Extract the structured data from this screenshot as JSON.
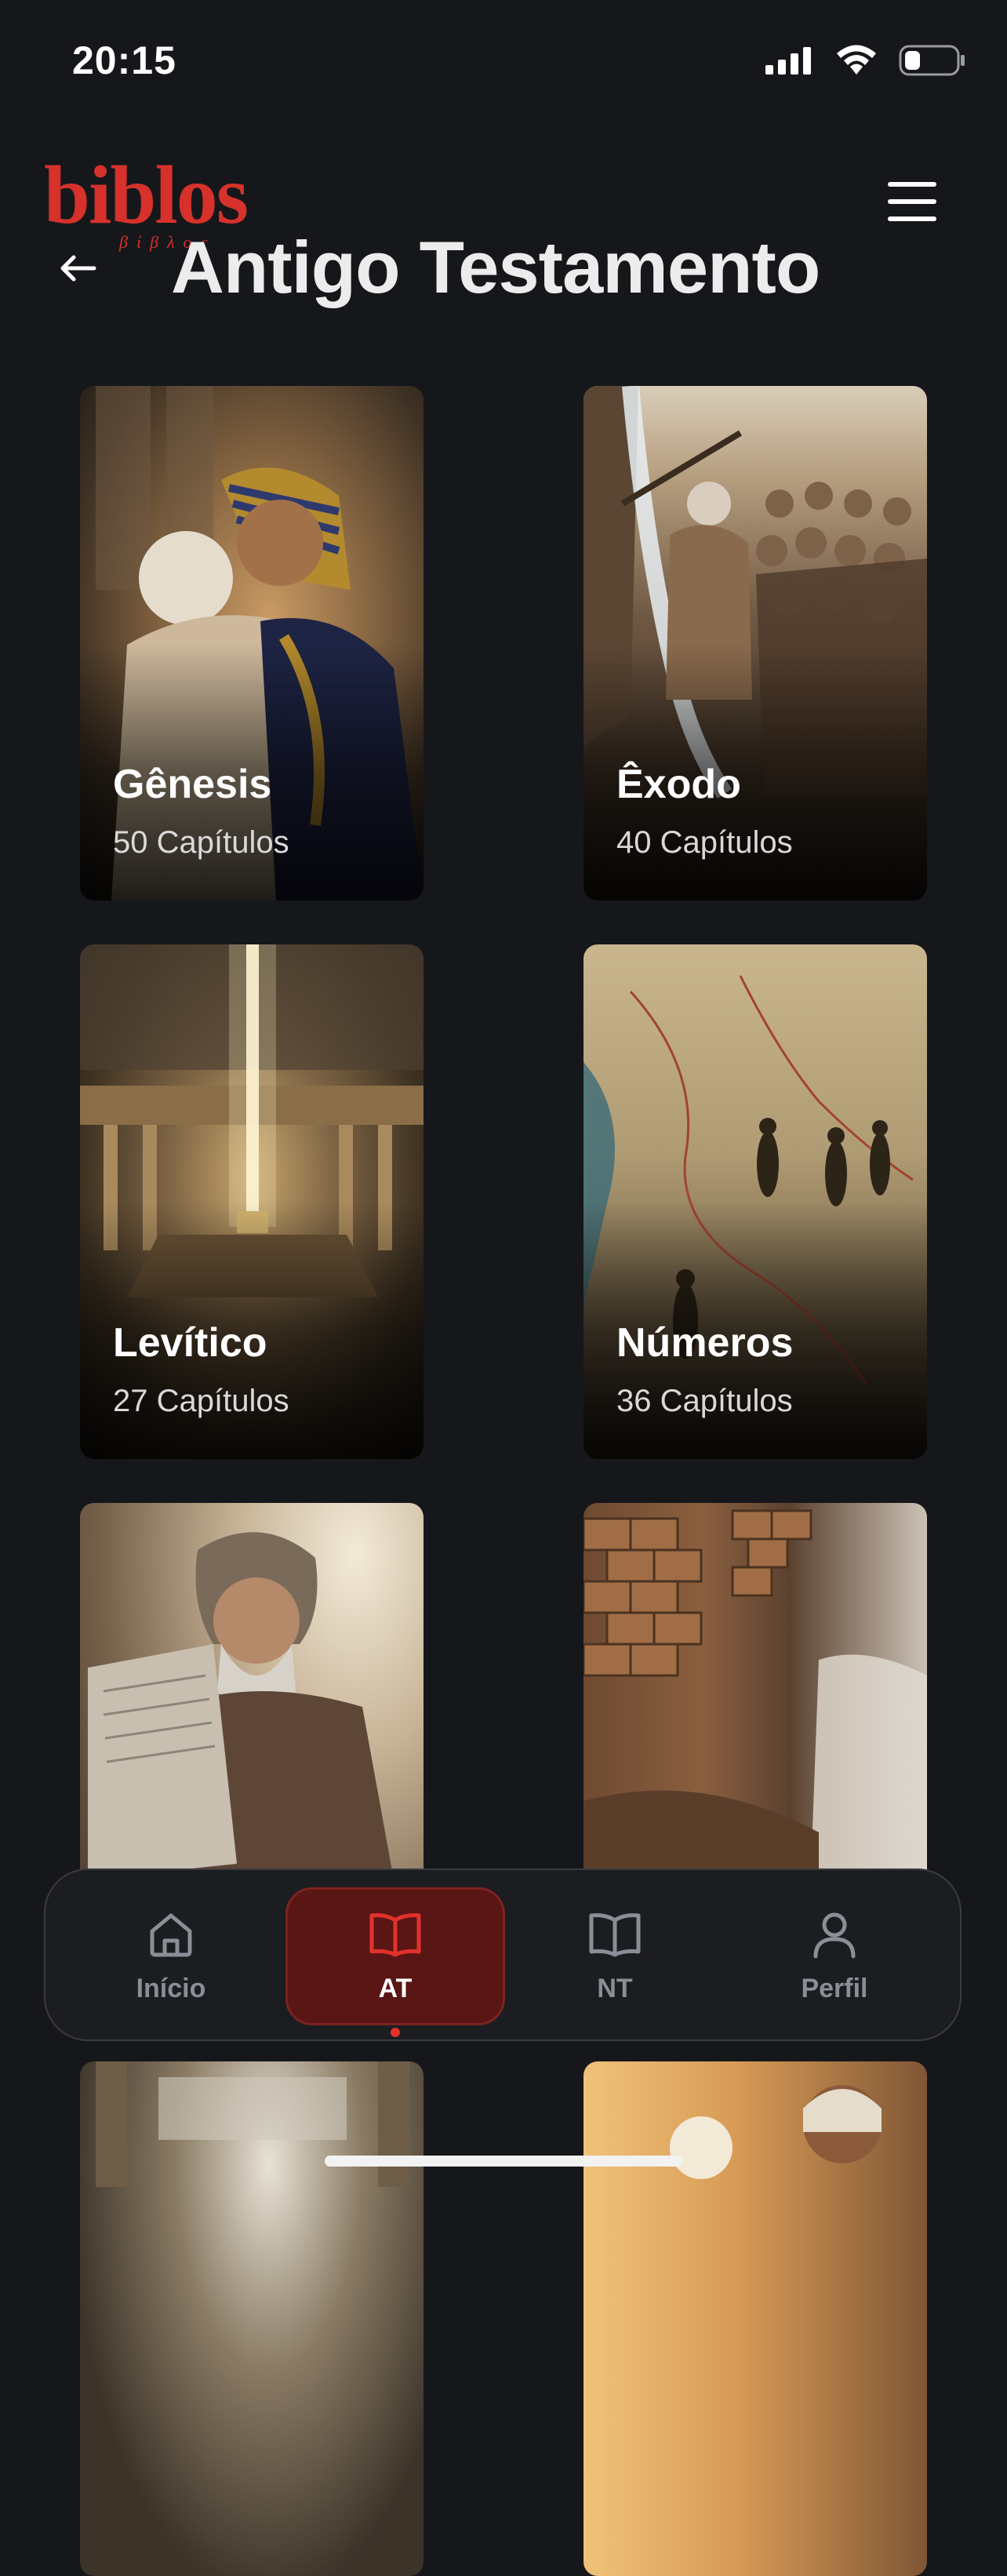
{
  "status_bar": {
    "time": "20:15",
    "battery_level": 0.3
  },
  "header": {
    "logo_text": "biblos",
    "logo_subtext": "βίβλος",
    "title": "Antigo Testamento",
    "back_icon": "arrow-left-icon",
    "menu_icon": "hamburger-menu-icon"
  },
  "books": [
    {
      "name": "Gênesis",
      "chapters": "50 Capítulos"
    },
    {
      "name": "Êxodo",
      "chapters": "40 Capítulos"
    },
    {
      "name": "Levítico",
      "chapters": "27 Capítulos"
    },
    {
      "name": "Números",
      "chapters": "36 Capítulos"
    },
    {
      "name": "",
      "chapters": ""
    },
    {
      "name": "",
      "chapters": ""
    },
    {
      "name": "",
      "chapters": ""
    },
    {
      "name": "",
      "chapters": ""
    }
  ],
  "nav": {
    "items": [
      {
        "label": "Início",
        "icon": "home-icon"
      },
      {
        "label": "AT",
        "icon": "book-open-icon",
        "active": true
      },
      {
        "label": "NT",
        "icon": "book-open-icon"
      },
      {
        "label": "Perfil",
        "icon": "user-icon"
      }
    ]
  },
  "colors": {
    "accent": "#d6312b",
    "background": "#16171b",
    "nav_active_bg": "#5a1515"
  }
}
